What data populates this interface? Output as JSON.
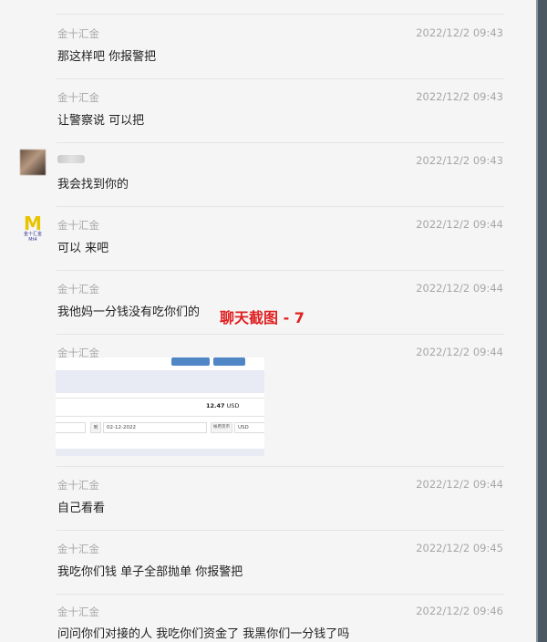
{
  "messages": [
    {
      "sender": "金十汇金",
      "time": "2022/12/2 09:43",
      "text": "那这样吧  你报警把"
    },
    {
      "sender": "金十汇金",
      "time": "2022/12/2 09:43",
      "text": "让警察说 可以把"
    },
    {
      "sender": "",
      "time": "2022/12/2 09:43",
      "text": "我会找到你的"
    },
    {
      "sender": "金十汇金",
      "time": "2022/12/2 09:44",
      "text": "可以 来吧"
    },
    {
      "sender": "金十汇金",
      "time": "2022/12/2 09:44",
      "text": "我他妈一分钱没有吃你们的"
    },
    {
      "sender": "金十汇金",
      "time": "2022/12/2 09:44",
      "text": ""
    },
    {
      "sender": "金十汇金",
      "time": "2022/12/2 09:44",
      "text": "自己看看"
    },
    {
      "sender": "金十汇金",
      "time": "2022/12/2 09:45",
      "text": "我吃你们钱  单子全部抛单 你报警把"
    },
    {
      "sender": "金十汇金",
      "time": "2022/12/2 09:46",
      "text": "问问你们对接的人  我吃你们资金了  我黑你们一分钱了吗"
    }
  ],
  "annotation": "聊天截图 - 7",
  "avatar_logo": {
    "letter": "M",
    "sub": "金十汇金Mt4"
  },
  "screenshot_image": {
    "amount": "12.47",
    "currency": "USD",
    "date_label": "到",
    "date_value": "02-12-2022",
    "field_label": "帐用货币",
    "field_value": "USD"
  },
  "colors": {
    "background": "#f5f5f5",
    "timestamp": "#a7a7a7",
    "annotation": "#e02020",
    "sidebar": "#4c5963"
  }
}
